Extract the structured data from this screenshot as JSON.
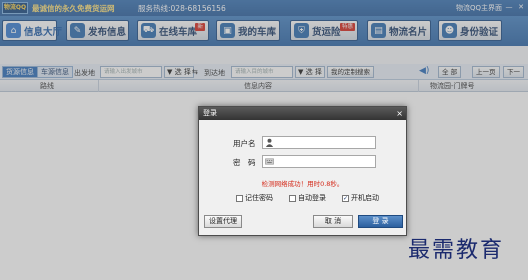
{
  "titlebar": {
    "logo": "物流QQ",
    "slogan": "最诚信的永久免费货运网",
    "hotline": "服务热线:028-68156156",
    "app_title": "物流QQ主界面",
    "min": "—",
    "close": "✕"
  },
  "nav": [
    {
      "label": "信息大厅",
      "icon": "home-icon",
      "color": "#3b7fd1",
      "badge": ""
    },
    {
      "label": "发布信息",
      "icon": "publish-icon",
      "color": "#2e6db0",
      "badge": ""
    },
    {
      "label": "在线车库",
      "icon": "truck-icon",
      "color": "#2e6db0",
      "badge": "新"
    },
    {
      "label": "我的车库",
      "icon": "garage-icon",
      "color": "#2e6db0",
      "badge": ""
    },
    {
      "label": "货运险",
      "icon": "insurance-icon",
      "color": "#2e6db0",
      "badge": "特惠"
    },
    {
      "label": "物流名片",
      "icon": "card-icon",
      "color": "#2e6db0",
      "badge": ""
    },
    {
      "label": "身份验证",
      "icon": "id-icon",
      "color": "#2e6db0",
      "badge": ""
    }
  ],
  "filter": {
    "tab_goods": "货源信息",
    "tab_vehicle": "车源信息",
    "from_label": "出发地",
    "from_placeholder": "请输入出发城市",
    "select": "▼ 选 择",
    "to_label": "到达地",
    "to_placeholder": "请输入目的城市",
    "custom_search": "我的定制搜索",
    "all": "全 部",
    "prev": "上一页",
    "next": "下一"
  },
  "table": {
    "col_route": "路线",
    "col_info": "信息内容",
    "col_park": "物流园-门牌号"
  },
  "dialog": {
    "title": "登录",
    "close": "×",
    "username_label": "用户名",
    "password_label": "密　码",
    "status": "检测网络成功！用时0.8秒。",
    "remember_password": "记住密码",
    "auto_login": "自动登录",
    "startup": "开机启动",
    "startup_checked": "✓",
    "proxy_button": "设置代理",
    "cancel_button": "取 消",
    "login_button": "登 录"
  },
  "watermark": "最需教育"
}
